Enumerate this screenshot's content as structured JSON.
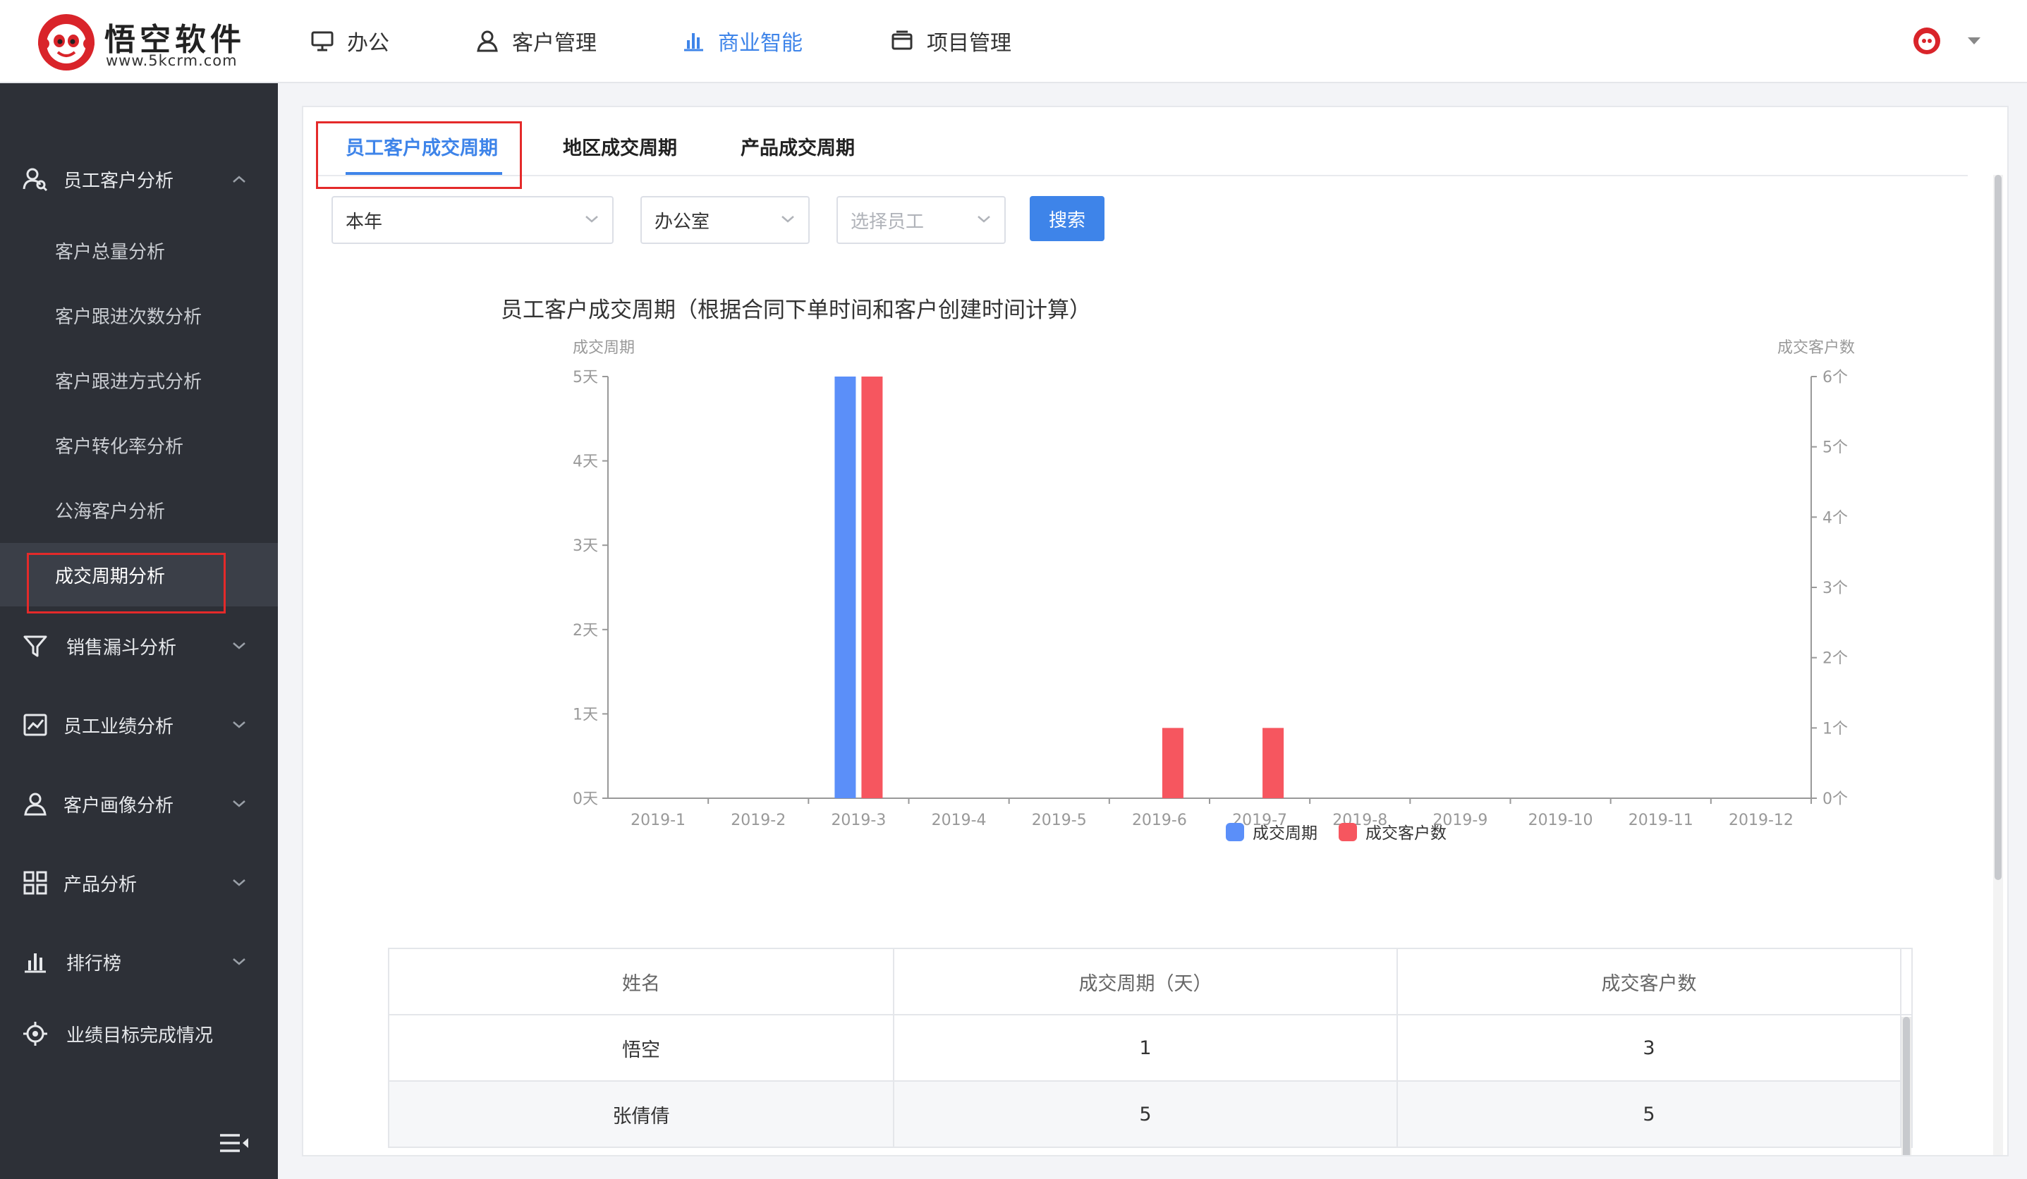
{
  "app": {
    "logo_name": "悟空软件",
    "logo_url": "www.5kcrm.com"
  },
  "nav": {
    "items": [
      {
        "label": "办公",
        "icon": "monitor-icon"
      },
      {
        "label": "客户管理",
        "icon": "person-icon"
      },
      {
        "label": "商业智能",
        "icon": "bar-chart-icon",
        "active": true
      },
      {
        "label": "项目管理",
        "icon": "folder-icon"
      }
    ]
  },
  "sidebar": {
    "groups": [
      {
        "label": "员工客户分析",
        "icon": "user-analysis-icon",
        "expanded": true
      },
      {
        "label": "销售漏斗分析",
        "icon": "funnel-icon"
      },
      {
        "label": "员工业绩分析",
        "icon": "line-chart-icon"
      },
      {
        "label": "客户画像分析",
        "icon": "person-icon"
      },
      {
        "label": "产品分析",
        "icon": "grid-icon"
      },
      {
        "label": "排行榜",
        "icon": "bar-chart-icon"
      },
      {
        "label": "业绩目标完成情况",
        "icon": "target-icon"
      }
    ],
    "subitems": [
      {
        "label": "客户总量分析"
      },
      {
        "label": "客户跟进次数分析"
      },
      {
        "label": "客户跟进方式分析"
      },
      {
        "label": "客户转化率分析"
      },
      {
        "label": "公海客户分析"
      },
      {
        "label": "成交周期分析",
        "active": true
      }
    ]
  },
  "tabs": [
    {
      "label": "员工客户成交周期",
      "active": true
    },
    {
      "label": "地区成交周期"
    },
    {
      "label": "产品成交周期"
    }
  ],
  "filters": {
    "period": "本年",
    "department": "办公室",
    "employee_placeholder": "选择员工",
    "search_label": "搜索"
  },
  "chart_data": {
    "type": "bar",
    "title": "员工客户成交周期（根据合同下单时间和客户创建时间计算）",
    "ylabel_left": "成交周期",
    "ylabel_right": "成交客户数",
    "categories": [
      "2019-1",
      "2019-2",
      "2019-3",
      "2019-4",
      "2019-5",
      "2019-6",
      "2019-7",
      "2019-8",
      "2019-9",
      "2019-10",
      "2019-11",
      "2019-12"
    ],
    "series": [
      {
        "name": "成交周期",
        "axis": "left",
        "color": "#5b8ff9",
        "values": [
          0,
          0,
          5,
          0,
          0,
          0,
          0,
          0,
          0,
          0,
          0,
          0
        ]
      },
      {
        "name": "成交客户数",
        "axis": "right",
        "color": "#f6565f",
        "values": [
          0,
          0,
          6,
          0,
          0,
          1,
          1,
          0,
          0,
          0,
          0,
          0
        ]
      }
    ],
    "ylim_left": [
      0,
      5
    ],
    "ylim_right": [
      0,
      6
    ],
    "yticks_left": [
      "0天",
      "1天",
      "2天",
      "3天",
      "4天",
      "5天"
    ],
    "yticks_right": [
      "0个",
      "1个",
      "2个",
      "3个",
      "4个",
      "5个",
      "6个"
    ],
    "legend": "bottom-center",
    "grid": false
  },
  "table": {
    "headers": [
      "姓名",
      "成交周期（天）",
      "成交客户数"
    ],
    "rows": [
      [
        "悟空",
        "1",
        "3"
      ],
      [
        "张倩倩",
        "5",
        "5"
      ]
    ]
  },
  "colors": {
    "accent": "#3e84e9",
    "sidebar_bg": "#2d3037",
    "highlight_box": "#e42a2a"
  }
}
